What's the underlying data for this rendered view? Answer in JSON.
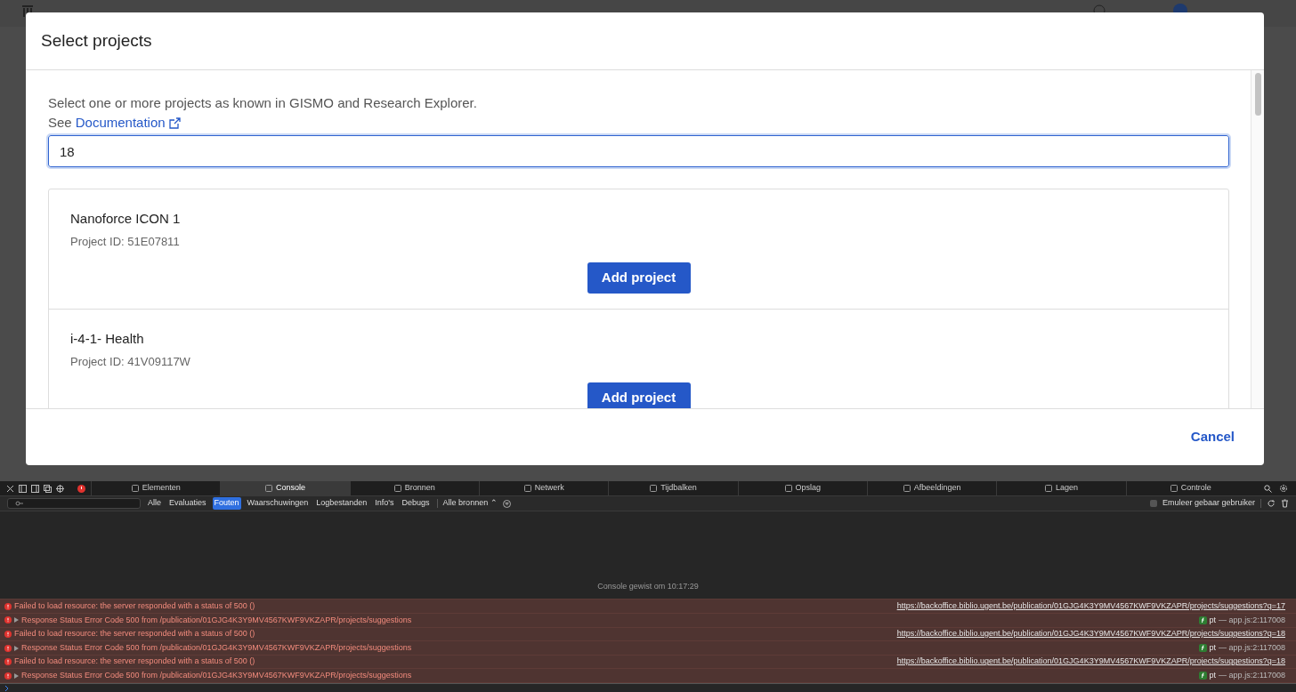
{
  "dialog": {
    "title": "Select projects",
    "intro": "Select one or more projects as known in GISMO and Research Explorer.",
    "see": "See",
    "doc_link": "Documentation",
    "search": {
      "value": "18"
    },
    "projects": [
      {
        "name": "Nanoforce ICON 1",
        "id": "Project ID: 51E07811",
        "button": "Add project"
      },
      {
        "name": "i-4-1- Health",
        "id": "Project ID: 41V09117W",
        "button": "Add project"
      }
    ],
    "cancel": "Cancel"
  },
  "devtools": {
    "tabs": [
      {
        "label": "Elementen",
        "selected": false
      },
      {
        "label": "Console",
        "selected": true
      },
      {
        "label": "Bronnen",
        "selected": false
      },
      {
        "label": "Netwerk",
        "selected": false
      },
      {
        "label": "Tijdbalken",
        "selected": false
      },
      {
        "label": "Opslag",
        "selected": false
      },
      {
        "label": "Afbeeldingen",
        "selected": false
      },
      {
        "label": "Lagen",
        "selected": false
      },
      {
        "label": "Controle",
        "selected": false
      }
    ],
    "filters": [
      {
        "label": "Alle",
        "selected": false
      },
      {
        "label": "Evaluaties",
        "selected": false
      },
      {
        "label": "Fouten",
        "selected": true
      },
      {
        "label": "Waarschuwingen",
        "selected": false
      },
      {
        "label": "Logbestanden",
        "selected": false
      },
      {
        "label": "Info's",
        "selected": false
      },
      {
        "label": "Debugs",
        "selected": false
      }
    ],
    "sources": "Alle bronnen ⌃",
    "emulate": {
      "label": "Emuleer gebaar gebruiker",
      "checked": false
    },
    "cleared": "Console gewist om 10:17:29",
    "messages": [
      {
        "kind": "resource",
        "text": "Failed to load resource: the server responded with a status of 500 ()",
        "link": "https://backoffice.biblio.ugent.be/publication/01GJG4K3Y9MV4567KWF9VKZAPR/projects/suggestions?q=17"
      },
      {
        "kind": "expandable",
        "text": "Response Status Error Code 500 from /publication/01GJG4K3Y9MV4567KWF9VKZAPR/projects/suggestions",
        "function": "pt",
        "location": "— app.js:2:117008"
      },
      {
        "kind": "resource",
        "text": "Failed to load resource: the server responded with a status of 500 ()",
        "link": "https://backoffice.biblio.ugent.be/publication/01GJG4K3Y9MV4567KWF9VKZAPR/projects/suggestions?q=18"
      },
      {
        "kind": "expandable",
        "text": "Response Status Error Code 500 from /publication/01GJG4K3Y9MV4567KWF9VKZAPR/projects/suggestions",
        "function": "pt",
        "location": "— app.js:2:117008"
      },
      {
        "kind": "resource",
        "text": "Failed to load resource: the server responded with a status of 500 ()",
        "link": "https://backoffice.biblio.ugent.be/publication/01GJG4K3Y9MV4567KWF9VKZAPR/projects/suggestions?q=18"
      },
      {
        "kind": "expandable",
        "text": "Response Status Error Code 500 from /publication/01GJG4K3Y9MV4567KWF9VKZAPR/projects/suggestions",
        "function": "pt",
        "location": "— app.js:2:117008"
      }
    ]
  }
}
